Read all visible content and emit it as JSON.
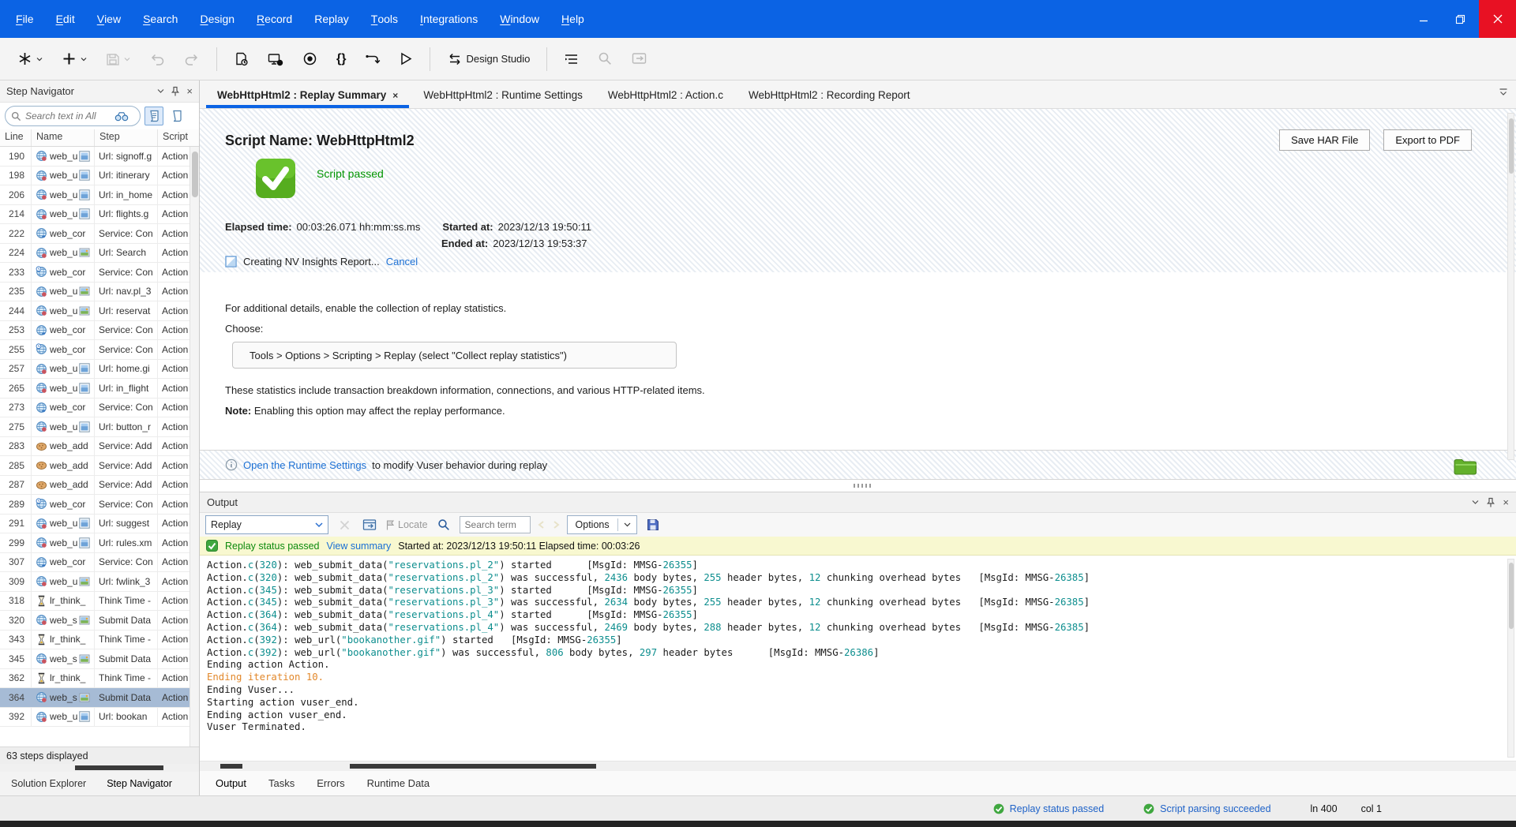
{
  "menu_bar": {
    "items": [
      {
        "label": "File",
        "u": 0
      },
      {
        "label": "Edit",
        "u": 0
      },
      {
        "label": "View",
        "u": 0
      },
      {
        "label": "Search",
        "u": 0
      },
      {
        "label": "Design",
        "u": 0
      },
      {
        "label": "Record",
        "u": 0
      },
      {
        "label": "Replay",
        "u": -1
      },
      {
        "label": "Tools",
        "u": 0
      },
      {
        "label": "Integrations",
        "u": 0
      },
      {
        "label": "Window",
        "u": 0
      },
      {
        "label": "Help",
        "u": 0
      }
    ]
  },
  "toolbar": {
    "design_studio_label": "Design Studio"
  },
  "step_navigator": {
    "title": "Step Navigator",
    "search_placeholder": "Search text in All",
    "columns": [
      "Line",
      "Name",
      "Step",
      "Script"
    ],
    "rows": [
      {
        "line": "190",
        "icon": "url",
        "name": "web_u",
        "after": "window",
        "step": "Url: signoff.g",
        "script": "Action"
      },
      {
        "line": "198",
        "icon": "url",
        "name": "web_u",
        "after": "window",
        "step": "Url: itinerary",
        "script": "Action"
      },
      {
        "line": "206",
        "icon": "url",
        "name": "web_u",
        "after": "window",
        "step": "Url: in_home",
        "script": "Action"
      },
      {
        "line": "214",
        "icon": "url",
        "name": "web_u",
        "after": "window",
        "step": "Url: flights.g",
        "script": "Action"
      },
      {
        "line": "222",
        "icon": "service",
        "name": "web_cor",
        "after": "",
        "step": "Service: Con",
        "script": "Action"
      },
      {
        "line": "224",
        "icon": "url",
        "name": "web_u",
        "after": "image",
        "step": "Url: Search",
        "script": "Action"
      },
      {
        "line": "233",
        "icon": "clock",
        "name": "web_cor",
        "after": "",
        "step": "Service: Con",
        "script": "Action"
      },
      {
        "line": "235",
        "icon": "url",
        "name": "web_u",
        "after": "image",
        "step": "Url: nav.pl_3",
        "script": "Action"
      },
      {
        "line": "244",
        "icon": "url",
        "name": "web_u",
        "after": "image",
        "step": "Url: reservat",
        "script": "Action"
      },
      {
        "line": "253",
        "icon": "service",
        "name": "web_cor",
        "after": "",
        "step": "Service: Con",
        "script": "Action"
      },
      {
        "line": "255",
        "icon": "clock",
        "name": "web_cor",
        "after": "",
        "step": "Service: Con",
        "script": "Action"
      },
      {
        "line": "257",
        "icon": "url",
        "name": "web_u",
        "after": "window",
        "step": "Url: home.gi",
        "script": "Action"
      },
      {
        "line": "265",
        "icon": "url",
        "name": "web_u",
        "after": "window",
        "step": "Url: in_flight",
        "script": "Action"
      },
      {
        "line": "273",
        "icon": "service",
        "name": "web_cor",
        "after": "",
        "step": "Service: Con",
        "script": "Action"
      },
      {
        "line": "275",
        "icon": "url",
        "name": "web_u",
        "after": "window",
        "step": "Url: button_r",
        "script": "Action"
      },
      {
        "line": "283",
        "icon": "cookie",
        "name": "web_add",
        "after": "",
        "step": "Service: Add",
        "script": "Action"
      },
      {
        "line": "285",
        "icon": "cookie",
        "name": "web_add",
        "after": "",
        "step": "Service: Add",
        "script": "Action"
      },
      {
        "line": "287",
        "icon": "cookie",
        "name": "web_add",
        "after": "",
        "step": "Service: Add",
        "script": "Action"
      },
      {
        "line": "289",
        "icon": "clock",
        "name": "web_cor",
        "after": "",
        "step": "Service: Con",
        "script": "Action"
      },
      {
        "line": "291",
        "icon": "url",
        "name": "web_u",
        "after": "window",
        "step": "Url: suggest",
        "script": "Action"
      },
      {
        "line": "299",
        "icon": "url",
        "name": "web_u",
        "after": "window",
        "step": "Url: rules.xm",
        "script": "Action"
      },
      {
        "line": "307",
        "icon": "service",
        "name": "web_cor",
        "after": "",
        "step": "Service: Con",
        "script": "Action"
      },
      {
        "line": "309",
        "icon": "url",
        "name": "web_u",
        "after": "image",
        "step": "Url: fwlink_3",
        "script": "Action"
      },
      {
        "line": "318",
        "icon": "think",
        "name": "lr_think_",
        "after": "",
        "step": "Think Time -",
        "script": "Action"
      },
      {
        "line": "320",
        "icon": "url",
        "name": "web_s",
        "after": "image",
        "step": "Submit Data",
        "script": "Action"
      },
      {
        "line": "343",
        "icon": "think",
        "name": "lr_think_",
        "after": "",
        "step": "Think Time -",
        "script": "Action"
      },
      {
        "line": "345",
        "icon": "url",
        "name": "web_s",
        "after": "image",
        "step": "Submit Data",
        "script": "Action"
      },
      {
        "line": "362",
        "icon": "think",
        "name": "lr_think_",
        "after": "",
        "step": "Think Time -",
        "script": "Action"
      },
      {
        "line": "364",
        "icon": "url",
        "name": "web_s",
        "after": "image",
        "step": "Submit Data",
        "script": "Action",
        "selected": true
      },
      {
        "line": "392",
        "icon": "url",
        "name": "web_u",
        "after": "window",
        "step": "Url: bookan",
        "script": "Action"
      }
    ],
    "footer": "63 steps displayed",
    "bottom_tabs": [
      {
        "label": "Solution Explorer",
        "active": false
      },
      {
        "label": "Step Navigator",
        "active": true
      }
    ]
  },
  "doc_tabs": [
    {
      "label": "WebHttpHtml2 : Replay Summary",
      "active": true
    },
    {
      "label": "WebHttpHtml2 : Runtime Settings",
      "active": false
    },
    {
      "label": "WebHttpHtml2 : Action.c",
      "active": false
    },
    {
      "label": "WebHttpHtml2 : Recording Report",
      "active": false
    }
  ],
  "summary": {
    "script_name": "Script Name: WebHttpHtml2",
    "save_har_label": "Save HAR File",
    "export_pdf_label": "Export to PDF",
    "status_text": "Script passed",
    "elapsed_label": "Elapsed time:",
    "elapsed_value": "00:03:26.071 hh:mm:ss.ms",
    "started_label": "Started at:",
    "started_value": "2023/12/13 19:50:11",
    "ended_label": "Ended at:",
    "ended_value": "2023/12/13 19:53:37",
    "nv_progress_text": "Creating NV Insights Report...",
    "nv_cancel_label": "Cancel",
    "details_text": "For additional details, enable the collection of replay statistics.",
    "choose_label": "Choose:",
    "path_text": "Tools > Options > Scripting > Replay (select \"Collect replay statistics\")",
    "stats_text": "These statistics include transaction breakdown information, connections, and various HTTP-related items.",
    "note_label": "Note:",
    "note_text": " Enabling this option may affect the replay performance.",
    "runtime_link_label": "Open the Runtime Settings",
    "runtime_suffix": " to modify Vuser behavior during replay"
  },
  "output": {
    "title": "Output",
    "filter_value": "Replay",
    "locate_label": "Locate",
    "search_placeholder": "Search term",
    "options_label": "Options",
    "status_text": "Replay status passed",
    "status_link": "View summary",
    "status_details": "Started at: 2023/12/13 19:50:11 Elapsed time: 00:03:26",
    "log_lines": [
      {
        "segs": [
          [
            "Action.",
            "n"
          ],
          [
            "c",
            "v"
          ],
          [
            "(",
            "n"
          ],
          [
            "320",
            "v"
          ],
          [
            "): web_submit_data(",
            "n"
          ],
          [
            "\"reservations.pl_2\"",
            "v"
          ],
          [
            ") started      [MsgId: MMSG-",
            "n"
          ],
          [
            "26355",
            "v"
          ],
          [
            "]",
            "n"
          ]
        ]
      },
      {
        "segs": [
          [
            "Action.",
            "n"
          ],
          [
            "c",
            "v"
          ],
          [
            "(",
            "n"
          ],
          [
            "320",
            "v"
          ],
          [
            "): web_submit_data(",
            "n"
          ],
          [
            "\"reservations.pl_2\"",
            "v"
          ],
          [
            ") was successful, ",
            "n"
          ],
          [
            "2436",
            "v"
          ],
          [
            " body bytes, ",
            "n"
          ],
          [
            "255",
            "v"
          ],
          [
            " header bytes, ",
            "n"
          ],
          [
            "12",
            "v"
          ],
          [
            " chunking overhead bytes   [MsgId: MMSG-",
            "n"
          ],
          [
            "26385",
            "v"
          ],
          [
            "]",
            "n"
          ]
        ]
      },
      {
        "segs": [
          [
            "Action.",
            "n"
          ],
          [
            "c",
            "v"
          ],
          [
            "(",
            "n"
          ],
          [
            "345",
            "v"
          ],
          [
            "): web_submit_data(",
            "n"
          ],
          [
            "\"reservations.pl_3\"",
            "v"
          ],
          [
            ") started      [MsgId: MMSG-",
            "n"
          ],
          [
            "26355",
            "v"
          ],
          [
            "]",
            "n"
          ]
        ]
      },
      {
        "segs": [
          [
            "Action.",
            "n"
          ],
          [
            "c",
            "v"
          ],
          [
            "(",
            "n"
          ],
          [
            "345",
            "v"
          ],
          [
            "): web_submit_data(",
            "n"
          ],
          [
            "\"reservations.pl_3\"",
            "v"
          ],
          [
            ") was successful, ",
            "n"
          ],
          [
            "2634",
            "v"
          ],
          [
            " body bytes, ",
            "n"
          ],
          [
            "255",
            "v"
          ],
          [
            " header bytes, ",
            "n"
          ],
          [
            "12",
            "v"
          ],
          [
            " chunking overhead bytes   [MsgId: MMSG-",
            "n"
          ],
          [
            "26385",
            "v"
          ],
          [
            "]",
            "n"
          ]
        ]
      },
      {
        "segs": [
          [
            "Action.",
            "n"
          ],
          [
            "c",
            "v"
          ],
          [
            "(",
            "n"
          ],
          [
            "364",
            "v"
          ],
          [
            "): web_submit_data(",
            "n"
          ],
          [
            "\"reservations.pl_4\"",
            "v"
          ],
          [
            ") started      [MsgId: MMSG-",
            "n"
          ],
          [
            "26355",
            "v"
          ],
          [
            "]",
            "n"
          ]
        ]
      },
      {
        "segs": [
          [
            "Action.",
            "n"
          ],
          [
            "c",
            "v"
          ],
          [
            "(",
            "n"
          ],
          [
            "364",
            "v"
          ],
          [
            "): web_submit_data(",
            "n"
          ],
          [
            "\"reservations.pl_4\"",
            "v"
          ],
          [
            ") was successful, ",
            "n"
          ],
          [
            "2469",
            "v"
          ],
          [
            " body bytes, ",
            "n"
          ],
          [
            "288",
            "v"
          ],
          [
            " header bytes, ",
            "n"
          ],
          [
            "12",
            "v"
          ],
          [
            " chunking overhead bytes   [MsgId: MMSG-",
            "n"
          ],
          [
            "26385",
            "v"
          ],
          [
            "]",
            "n"
          ]
        ]
      },
      {
        "segs": [
          [
            "Action.",
            "n"
          ],
          [
            "c",
            "v"
          ],
          [
            "(",
            "n"
          ],
          [
            "392",
            "v"
          ],
          [
            "): web_url(",
            "n"
          ],
          [
            "\"bookanother.gif\"",
            "v"
          ],
          [
            ") started   [MsgId: MMSG-",
            "n"
          ],
          [
            "26355",
            "v"
          ],
          [
            "]",
            "n"
          ]
        ]
      },
      {
        "segs": [
          [
            "Action.",
            "n"
          ],
          [
            "c",
            "v"
          ],
          [
            "(",
            "n"
          ],
          [
            "392",
            "v"
          ],
          [
            "): web_url(",
            "n"
          ],
          [
            "\"bookanother.gif\"",
            "v"
          ],
          [
            ") was successful, ",
            "n"
          ],
          [
            "806",
            "v"
          ],
          [
            " body bytes, ",
            "n"
          ],
          [
            "297",
            "v"
          ],
          [
            " header bytes      [MsgId: MMSG-",
            "n"
          ],
          [
            "26386",
            "v"
          ],
          [
            "]",
            "n"
          ]
        ]
      },
      {
        "segs": [
          [
            "Ending action Action.",
            "n"
          ]
        ]
      },
      {
        "segs": [
          [
            "Ending iteration 10.",
            "o"
          ]
        ]
      },
      {
        "segs": [
          [
            "Ending Vuser...",
            "n"
          ]
        ]
      },
      {
        "segs": [
          [
            "Starting action vuser_end.",
            "n"
          ]
        ]
      },
      {
        "segs": [
          [
            "Ending action vuser_end.",
            "n"
          ]
        ]
      },
      {
        "segs": [
          [
            "Vuser Terminated.",
            "n"
          ]
        ]
      }
    ],
    "bottom_tabs": [
      {
        "label": "Output",
        "active": true
      },
      {
        "label": "Tasks",
        "active": false
      },
      {
        "label": "Errors",
        "active": false
      },
      {
        "label": "Runtime Data",
        "active": false
      }
    ]
  },
  "status_bar": {
    "replay_status": "Replay status passed",
    "parsing_status": "Script parsing succeeded",
    "line_indicator": "ln 400",
    "col_indicator": "col 1"
  }
}
